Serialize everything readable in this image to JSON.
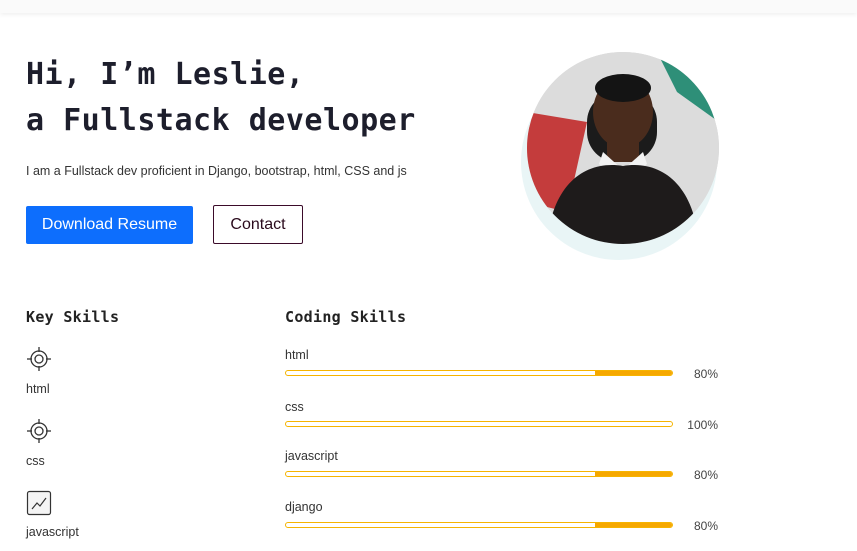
{
  "hero": {
    "title_line1": "Hi, I’m Leslie,",
    "title_line2": "a Fullstack developer",
    "description": "I am a Fullstack dev proficient in Django, bootstrap, html, CSS and js",
    "download_label": "Download Resume",
    "contact_label": "Contact"
  },
  "key_skills": {
    "title": "Key Skills",
    "items": [
      {
        "label": "html",
        "icon": "target-icon"
      },
      {
        "label": "css",
        "icon": "target-icon"
      },
      {
        "label": "javascript",
        "icon": "chart-line-icon"
      }
    ]
  },
  "coding_skills": {
    "title": "Coding Skills",
    "items": [
      {
        "label": "html",
        "percent": "80%",
        "value": 80
      },
      {
        "label": "css",
        "percent": "100%",
        "value": 100
      },
      {
        "label": "javascript",
        "percent": "80%",
        "value": 80
      },
      {
        "label": "django",
        "percent": "80%",
        "value": 80
      }
    ]
  },
  "colors": {
    "primary": "#0d6efd",
    "accent": "#f6a800",
    "title": "#1d1e2c"
  }
}
